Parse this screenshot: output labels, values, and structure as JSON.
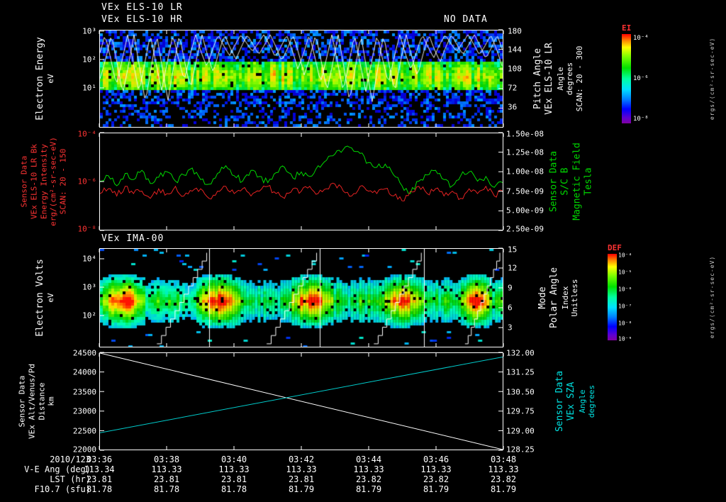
{
  "colors": {
    "accent_red": "#ff3333",
    "green": "#00d800",
    "cyan": "#00e0e0",
    "white": "#ffffff"
  },
  "panel1": {
    "title1": "VEx ELS-10 LR",
    "title2": "VEx ELS-10 HR",
    "no_data": "NO DATA",
    "left_label": [
      "Electron Energy",
      "eV"
    ],
    "left_ticks": [
      "10³",
      "10²",
      "10¹"
    ],
    "right_ticks": [
      "180",
      "144",
      "108",
      "72",
      "36"
    ],
    "right_label": [
      "Pitch Angle",
      "VEx ELS-10 LR",
      "Angle",
      "degrees",
      "SCAN: 20 - 300"
    ],
    "colorbar": {
      "title": "EI",
      "ticks": [
        "10⁻⁴",
        "10⁻⁶",
        "10⁻⁸"
      ],
      "units": "ergs/(cm²-sr-sec-eV)"
    }
  },
  "panel2": {
    "left_label": [
      "Sensor Data",
      "VEx ELS-10 LR Bk",
      "Energy Intensity",
      "erg/(cm²-sr-sec-eV)",
      "SCAN: 20 - 150"
    ],
    "left_ticks": [
      "10⁻⁴",
      "10⁻⁶",
      "10⁻⁸"
    ],
    "right_ticks": [
      "1.50e-08",
      "1.25e-08",
      "1.00e-08",
      "7.50e-09",
      "5.00e-09",
      "2.50e-09"
    ],
    "right_label": [
      "Sensor Data",
      "S/C B",
      "Magnetic Field",
      "Tesla"
    ]
  },
  "panel3": {
    "title": "VEx IMA-00",
    "left_label": [
      "Electron Volts",
      "eV"
    ],
    "left_ticks": [
      "10⁴",
      "10³",
      "10²"
    ],
    "right_ticks": [
      "15",
      "12",
      "9",
      "6",
      "3"
    ],
    "right_label": [
      "Mode",
      "Polar Angle",
      "Index",
      "Unitless"
    ],
    "colorbar": {
      "title": "DEF",
      "ticks": [
        "10⁻⁴",
        "10⁻⁵",
        "10⁻⁶",
        "10⁻⁷",
        "10⁻⁸",
        "10⁻⁹"
      ],
      "units": "ergs/(cm²-sr-sec-eV)"
    }
  },
  "panel4": {
    "left_label": [
      "Sensor Data",
      "VEx Alt/Venus/Pd",
      "Distance",
      "km"
    ],
    "left_ticks": [
      "24500",
      "24000",
      "23500",
      "23000",
      "22500",
      "22000"
    ],
    "right_ticks": [
      "132.00",
      "131.25",
      "130.50",
      "129.75",
      "129.00",
      "128.25"
    ],
    "right_label": [
      "Sensor Data",
      "VEx SZA",
      "Angle",
      "degrees"
    ]
  },
  "footer": {
    "date_label": "2010/123",
    "times": [
      "03:36",
      "03:38",
      "03:40",
      "03:42",
      "03:44",
      "03:46",
      "03:48"
    ],
    "rows": [
      {
        "label": "V-E Ang (deg)",
        "values": [
          "113.34",
          "113.33",
          "113.33",
          "113.33",
          "113.33",
          "113.33",
          "113.33"
        ]
      },
      {
        "label": "LST (hr)",
        "values": [
          "23.81",
          "23.81",
          "23.81",
          "23.81",
          "23.82",
          "23.82",
          "23.82"
        ]
      },
      {
        "label": "F10.7 (sfu)",
        "values": [
          "81.78",
          "81.78",
          "81.78",
          "81.79",
          "81.79",
          "81.79",
          "81.79"
        ]
      }
    ]
  },
  "chart_data": [
    {
      "type": "heatmap",
      "title": "VEx ELS-10 LR / VEx ELS-10 HR electron energy-time spectrogram",
      "ylabel": "Electron Energy (eV)",
      "y_scale": "log",
      "y_ticks": [
        "10³",
        "10²",
        "10¹"
      ],
      "x_ticks": [
        "03:36",
        "03:38",
        "03:40",
        "03:42",
        "03:44",
        "03:46",
        "03:48"
      ],
      "right_axis": {
        "label": "Pitch Angle (degrees), VEx ELS-10 LR, SCAN: 20 - 300",
        "ticks": [
          180,
          144,
          108,
          72,
          36
        ]
      },
      "colorbar": {
        "label": "EI",
        "ticks": [
          "10⁻⁴",
          "10⁻⁶",
          "10⁻⁸"
        ],
        "units": "ergs/(cm²-sr-sec-eV)"
      },
      "pattern": {
        "bright_band_eV": [
          20,
          200
        ],
        "description": "continuous green/yellow-green flux band from ~20-200 eV across the whole interval, blue speckle above and below, jagged white pitch-angle trace lines, HR channel NO DATA"
      }
    },
    {
      "type": "line",
      "x_ticks": [
        "03:36",
        "03:38",
        "03:40",
        "03:42",
        "03:44",
        "03:46",
        "03:48"
      ],
      "left_axis": {
        "label": "Energy Intensity erg/(cm²-sr-sec-eV)",
        "scale": "log",
        "range": [
          "10⁻⁸",
          "10⁻⁴"
        ]
      },
      "right_axis": {
        "label": "S/C B Magnetic Field (Tesla)",
        "range": [
          2.5e-09,
          1.5e-08
        ]
      },
      "series": [
        {
          "name": "VEx ELS-10 LR Bk Energy Intensity",
          "color": "#e62222",
          "axis": "left",
          "log10_values": [
            -6.5,
            -6.3,
            -6.6,
            -6.2,
            -6.5,
            -6.4,
            -6.7,
            -6.3,
            -6.5,
            -6.2,
            -6.6,
            -6.4,
            -6.3,
            -6.7,
            -6.4,
            -6.2,
            -6.5,
            -6.3,
            -6.6,
            -6.4,
            -6.2,
            -6.5,
            -6.7,
            -6.3,
            -6.4,
            -6.2,
            -6.5,
            -6.3,
            -6.1,
            -6.4,
            -6.6,
            -6.2,
            -6.4,
            -6.5,
            -6.3,
            -6.6,
            -6.8,
            -6.4,
            -6.2,
            -6.5,
            -6.3,
            -6.6,
            -6.4,
            -6.7,
            -6.3,
            -6.5,
            -6.2,
            -6.6,
            -6.4
          ]
        },
        {
          "name": "S/C B Magnetic Field",
          "color": "#00d800",
          "axis": "right",
          "values_1e9": [
            8.8,
            9.5,
            8.2,
            9.8,
            9.0,
            10.2,
            8.5,
            9.3,
            10.0,
            8.8,
            9.6,
            10.5,
            9.0,
            8.4,
            9.8,
            10.8,
            9.5,
            8.8,
            10.2,
            9.4,
            8.6,
            9.9,
            10.6,
            9.2,
            10.0,
            9.4,
            10.8,
            11.5,
            12.3,
            12.9,
            13.1,
            12.4,
            11.2,
            10.6,
            11.0,
            9.6,
            8.2,
            7.2,
            8.8,
            9.6,
            10.2,
            9.0,
            8.2,
            9.5,
            10.0,
            8.8,
            9.4,
            8.0,
            8.6
          ]
        }
      ]
    },
    {
      "type": "heatmap",
      "title": "VEx IMA-00 ion energy-time spectrogram",
      "ylabel": "Electron Volts (eV)",
      "y_scale": "log",
      "y_ticks": [
        "10⁴",
        "10³",
        "10²"
      ],
      "x_ticks": [
        "03:36",
        "03:38",
        "03:40",
        "03:42",
        "03:44",
        "03:46",
        "03:48"
      ],
      "right_axis": {
        "label": "Mode / Polar Angle Index (Unitless)",
        "ticks": [
          15,
          12,
          9,
          6,
          3
        ]
      },
      "colorbar": {
        "label": "DEF",
        "ticks": [
          "10⁻⁴",
          "10⁻⁵",
          "10⁻⁶",
          "10⁻⁷",
          "10⁻⁸",
          "10⁻⁹"
        ],
        "units": "ergs/(cm²-sr-sec-eV)"
      },
      "pattern": {
        "segments": 4,
        "divider_x_fractions": [
          0.272,
          0.545,
          0.805
        ],
        "description": "four telemetry segments separated by white vertical lines; intense red/yellow ion beam band near a few hundred eV with green/cyan/blue halo; white staircase mode lines climbing across each segment; sparse blue dashes elsewhere"
      }
    },
    {
      "type": "line",
      "x_ticks": [
        "03:36",
        "03:38",
        "03:40",
        "03:42",
        "03:44",
        "03:46",
        "03:48"
      ],
      "left_axis": {
        "label": "VEx Alt/Venus/Pd Distance (km)",
        "range": [
          22000,
          24500
        ]
      },
      "right_axis": {
        "label": "VEx SZA (degrees)",
        "range": [
          128.25,
          132.0
        ]
      },
      "series": [
        {
          "name": "VEx Alt/Venus/Pd Distance",
          "color": "#ffffff",
          "axis": "left",
          "x_fraction": [
            0,
            1
          ],
          "values": [
            24500,
            22000
          ]
        },
        {
          "name": "VEx SZA Angle",
          "color": "#00cccc",
          "axis": "right",
          "x_fraction": [
            0,
            1
          ],
          "values": [
            128.9,
            131.85
          ]
        }
      ]
    }
  ]
}
